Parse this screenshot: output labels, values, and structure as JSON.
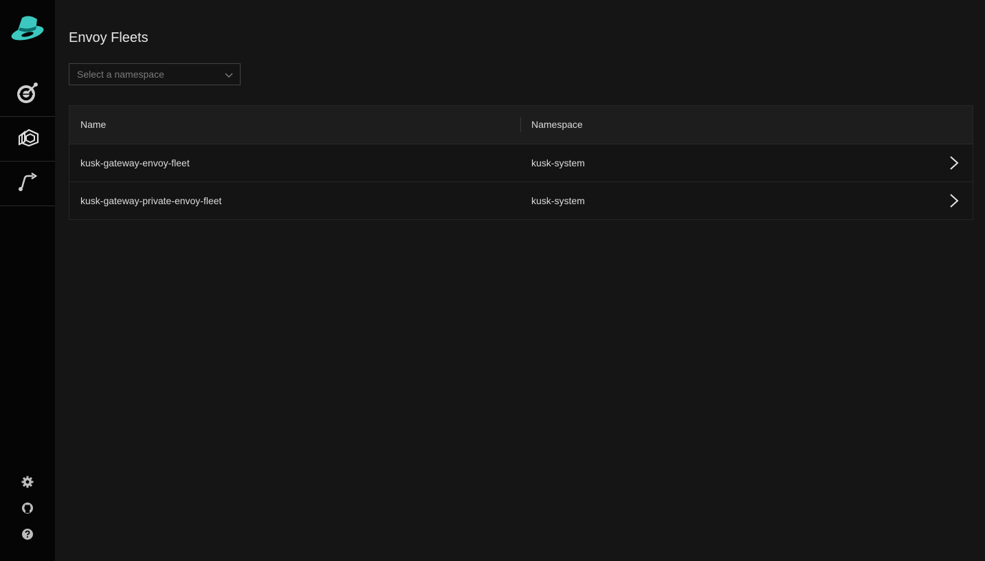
{
  "colors": {
    "accent": "#3cc8c0",
    "background": "#151515",
    "sidebar": "#050505"
  },
  "sidebar": {
    "logo": "kusk-hat-logo",
    "items": [
      {
        "icon": "dashboard-dial-icon"
      },
      {
        "icon": "envoy-fleet-icon",
        "active": true
      },
      {
        "icon": "routes-arrow-icon"
      }
    ],
    "bottom": [
      {
        "icon": "gear-icon"
      },
      {
        "icon": "github-icon"
      },
      {
        "icon": "help-icon"
      }
    ]
  },
  "page": {
    "title": "Envoy Fleets"
  },
  "namespace_select": {
    "placeholder": "Select a namespace"
  },
  "table": {
    "columns": [
      "Name",
      "Namespace"
    ],
    "rows": [
      {
        "name": "kusk-gateway-envoy-fleet",
        "namespace": "kusk-system"
      },
      {
        "name": "kusk-gateway-private-envoy-fleet",
        "namespace": "kusk-system"
      }
    ]
  }
}
